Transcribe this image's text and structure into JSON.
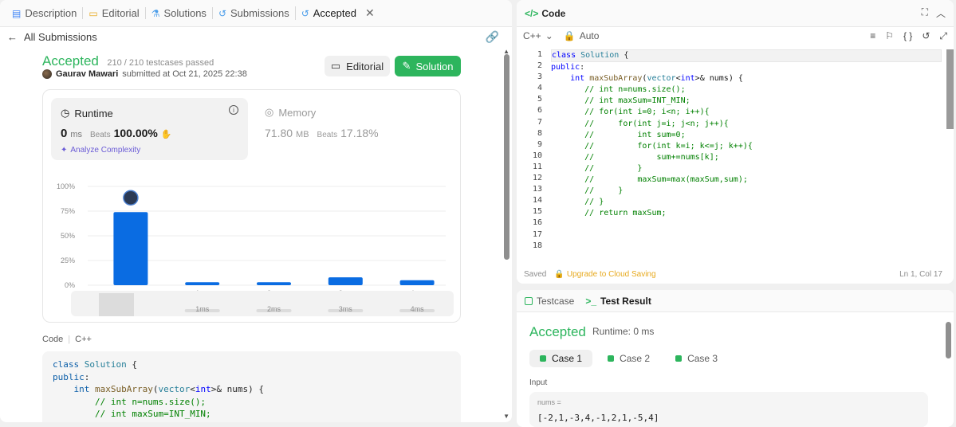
{
  "left_tabs": [
    {
      "label": "Description",
      "icon": "document-icon"
    },
    {
      "label": "Editorial",
      "icon": "book-icon"
    },
    {
      "label": "Solutions",
      "icon": "flask-icon"
    },
    {
      "label": "Submissions",
      "icon": "history-icon"
    },
    {
      "label": "Accepted",
      "icon": "history-icon"
    }
  ],
  "subhead": {
    "back_label": "All Submissions"
  },
  "result": {
    "status": "Accepted",
    "testcases": "210 / 210 testcases passed",
    "author": "Gaurav Mawari",
    "submitted": "submitted at Oct 21, 2025 22:38"
  },
  "buttons": {
    "editorial": "Editorial",
    "solution": "Solution"
  },
  "runtime": {
    "label": "Runtime",
    "value": "0",
    "unit": "ms",
    "beats_label": "Beats",
    "beats_pct": "100.00%",
    "analyze": "Analyze Complexity"
  },
  "memory": {
    "label": "Memory",
    "value": "71.80",
    "unit": "MB",
    "beats_label": "Beats",
    "beats_pct": "17.18%"
  },
  "chart_data": {
    "type": "bar",
    "categories": [
      "0ms",
      "1ms",
      "2ms",
      "3ms",
      "4ms"
    ],
    "x_tick_labels": [
      "",
      "1ms",
      "2ms",
      "3ms",
      "4ms"
    ],
    "values": [
      74,
      3,
      3,
      8,
      5
    ],
    "y_ticks": [
      "100%",
      "75%",
      "50%",
      "25%",
      "0%"
    ],
    "ylim": [
      0,
      100
    ],
    "grid": true,
    "bar_color": "#0a6ce2",
    "selected_category": "0ms",
    "scrubber_labels": [
      "1ms",
      "2ms",
      "3ms",
      "4ms"
    ]
  },
  "code_section": {
    "label": "Code",
    "lang": "C++"
  },
  "preview_code": [
    "class Solution {",
    "public:",
    "    int maxSubArray(vector<int>& nums) {",
    "        // int n=nums.size();",
    "        // int maxSum=INT_MIN;"
  ],
  "editor": {
    "title": "Code",
    "language": "C++",
    "mode": "Auto",
    "status_saved": "Saved",
    "upgrade": "Upgrade to Cloud Saving",
    "cursor": "Ln 1, Col 17",
    "line_numbers": [
      "1",
      "2",
      "3",
      "4",
      "5",
      "6",
      "7",
      "8",
      "9",
      "10",
      "11",
      "12",
      "13",
      "14",
      "15",
      "16",
      "17",
      "18"
    ],
    "lines": [
      "class Solution {",
      "public:",
      "    int maxSubArray(vector<int>& nums) {",
      "       // int n=nums.size();",
      "       // int maxSum=INT_MIN;",
      "       // for(int i=0; i<n; i++){",
      "       //     for(int j=i; j<n; j++){",
      "       //         int sum=0;",
      "       //         for(int k=i; k<=j; k++){",
      "       //             sum+=nums[k];",
      "       //         }",
      "       //         maxSum=max(maxSum,sum);",
      "       //     }",
      "       // }",
      "       // return maxSum;",
      "",
      "",
      ""
    ]
  },
  "testpanel": {
    "tab_testcase": "Testcase",
    "tab_result": "Test Result",
    "status": "Accepted",
    "runtime": "Runtime: 0 ms",
    "cases": [
      "Case 1",
      "Case 2",
      "Case 3"
    ],
    "input_label": "Input",
    "input_name": "nums =",
    "input_value": "[-2,1,-3,4,-1,2,1,-5,4]"
  },
  "colors": {
    "accent_green": "#2db55d",
    "bar_blue": "#0a6ce2",
    "upgrade_amber": "#e7a91d"
  }
}
